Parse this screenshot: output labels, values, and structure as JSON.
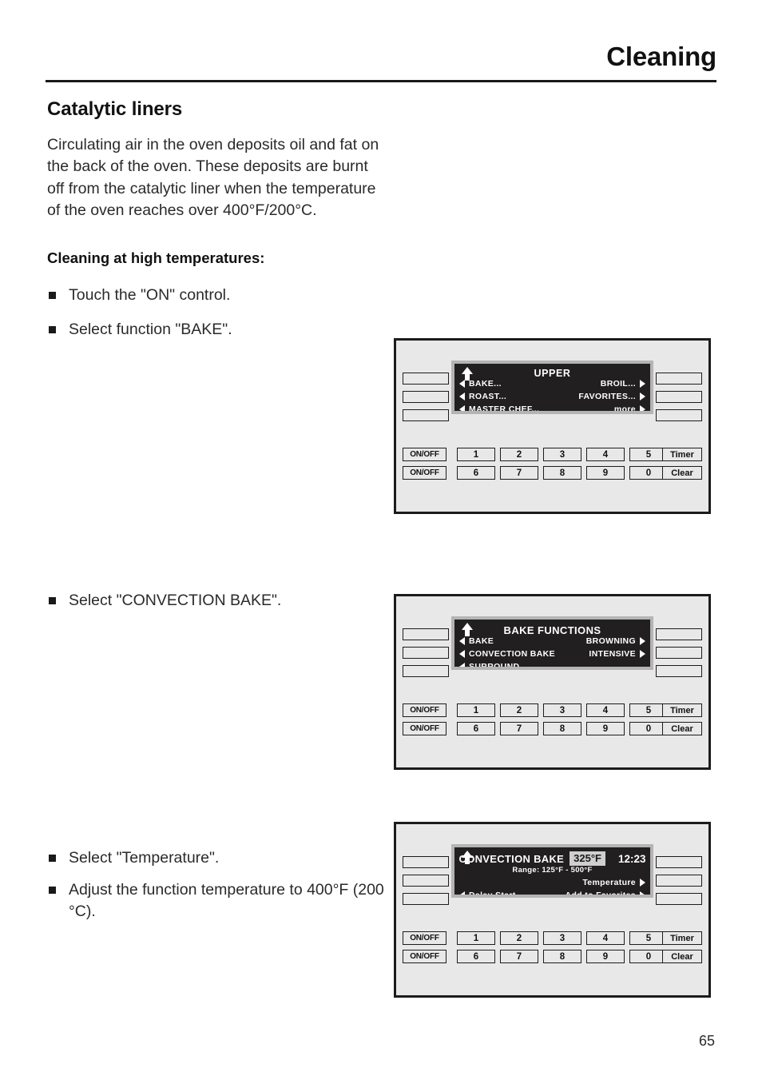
{
  "header": {
    "title": "Cleaning"
  },
  "section": {
    "heading": "Catalytic liners",
    "paragraph": "Circulating air in the oven deposits oil and fat on the back of the oven. These deposits are burnt off from the catalytic liner when the temperature of the oven reaches over 400°F/200°C.",
    "subheading": "Cleaning at high temperatures:"
  },
  "steps": {
    "step1": "Touch the \"ON\" control.",
    "step2": "Select function \"BAKE\".",
    "step3": "Select \"CONVECTION BAKE\".",
    "step4": "Select \"Temperature\".",
    "step5": "Adjust the function temperature to 400°F (200 °C)."
  },
  "keypad": {
    "onoff_upper": "ON/OFF",
    "onoff_lower": "ON/OFF",
    "row1": [
      "1",
      "2",
      "3",
      "4",
      "5"
    ],
    "row2": [
      "6",
      "7",
      "8",
      "9",
      "0"
    ],
    "timer": "Timer",
    "clear": "Clear"
  },
  "panel1": {
    "lcd_title": "UPPER",
    "left_items": [
      "BAKE...",
      "ROAST...",
      "MASTER CHEF..."
    ],
    "right_items": [
      "BROIL...",
      "FAVORITES...",
      "more"
    ]
  },
  "panel2": {
    "lcd_title": "BAKE FUNCTIONS",
    "left_items": [
      "BAKE",
      "CONVECTION BAKE",
      "SURROUND"
    ],
    "right_items": [
      "BROWNING",
      "INTENSIVE"
    ]
  },
  "panel3": {
    "lcd_title": "CONVECTION BAKE",
    "temperature": "325°F",
    "clock": "12:23",
    "range": "Range: 125°F - 500°F",
    "right_items": [
      "Temperature",
      "Add to Favorites"
    ],
    "left_items": [
      "Delay Start"
    ]
  },
  "footer": {
    "page_number": "65"
  },
  "colors": {
    "panel_background": "#e8e8e8",
    "panel_border": "#1c1c1c",
    "lcd_background": "#211f20",
    "lcd_border": "#b4b4b4",
    "lcd_text": "#ffffff",
    "highlight_background": "#cfcfcf"
  }
}
